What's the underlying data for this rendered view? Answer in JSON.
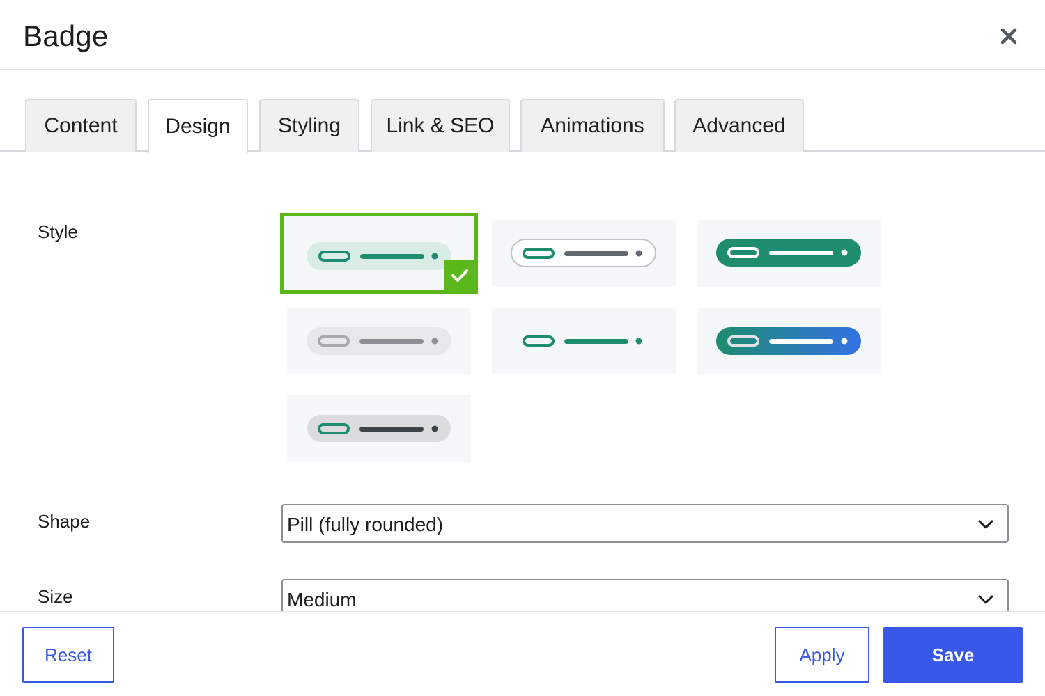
{
  "header": {
    "title": "Badge"
  },
  "tabs": [
    {
      "label": "Content"
    },
    {
      "label": "Design"
    },
    {
      "label": "Styling"
    },
    {
      "label": "Link & SEO"
    },
    {
      "label": "Animations"
    },
    {
      "label": "Advanced"
    }
  ],
  "active_tab": "Design",
  "fields": {
    "style": {
      "label": "Style",
      "options": [
        "soft",
        "outline",
        "solid",
        "gray",
        "minimal",
        "gradient",
        "neutral"
      ],
      "selected": "soft"
    },
    "shape": {
      "label": "Shape",
      "value": "Pill (fully rounded)"
    },
    "size": {
      "label": "Size",
      "value": "Medium"
    }
  },
  "footer": {
    "reset_label": "Reset",
    "apply_label": "Apply",
    "save_label": "Save"
  },
  "colors": {
    "accent": "#3858e9",
    "selected": "#5cb71b",
    "badge_green": "#1e8c6e",
    "badge_blue": "#3472e6"
  }
}
